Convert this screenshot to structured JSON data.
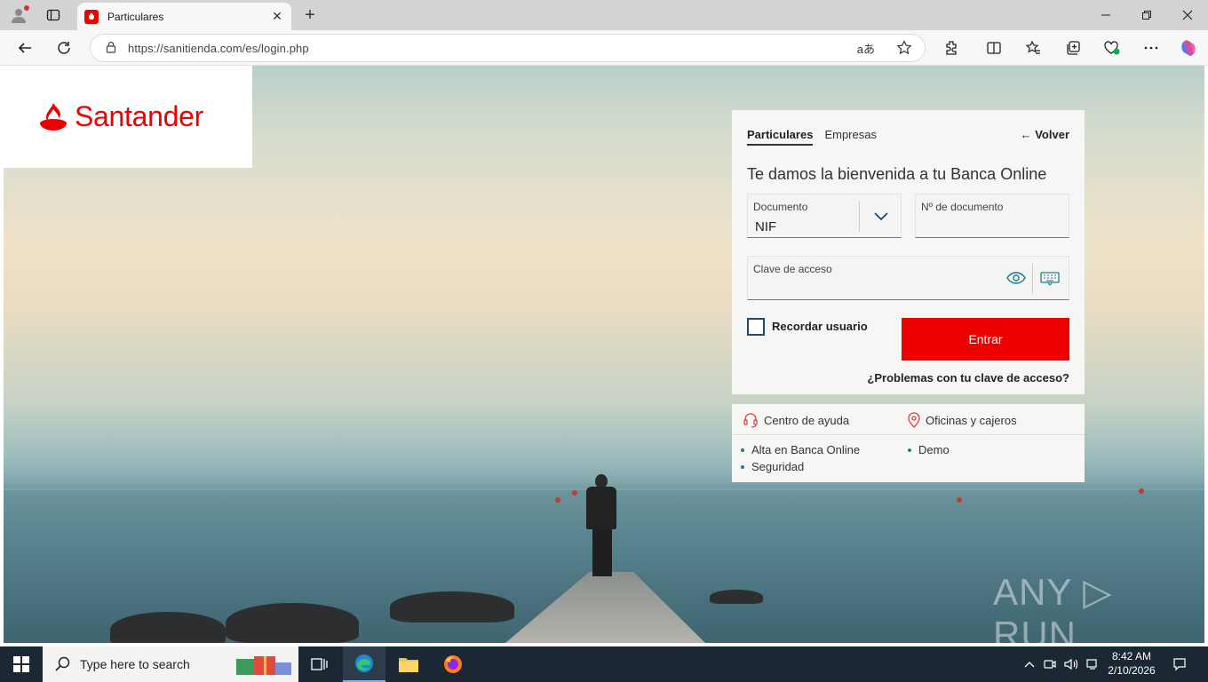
{
  "browser": {
    "tab_title": "Particulares",
    "url": "https://sanitienda.com/es/login.php",
    "read_aloud_label": "aあ"
  },
  "site": {
    "logo_text": "Santander",
    "brand_color": "#ec0000"
  },
  "login": {
    "tabs": [
      "Particulares",
      "Empresas"
    ],
    "back_label": "← Volver",
    "welcome": "Te damos la bienvenida a tu Banca Online",
    "doc_type_label": "Documento",
    "doc_type_value": "NIF",
    "doc_number_label": "Nº de documento",
    "doc_number_value": "",
    "password_label": "Clave de acceso",
    "remember_label": "Recordar usuario",
    "submit_label": "Entrar",
    "problems_link": "¿Problemas con tu clave de acceso?"
  },
  "help": {
    "help_center": "Centro de ayuda",
    "offices": "Oficinas y cajeros",
    "links_left": [
      "Alta en Banca Online",
      "Seguridad"
    ],
    "links_right": [
      "Demo"
    ]
  },
  "watermark": "ANY ▷ RUN",
  "taskbar": {
    "search_placeholder": "Type here to search",
    "time": "8:42 AM",
    "date": "2/10/2026"
  }
}
